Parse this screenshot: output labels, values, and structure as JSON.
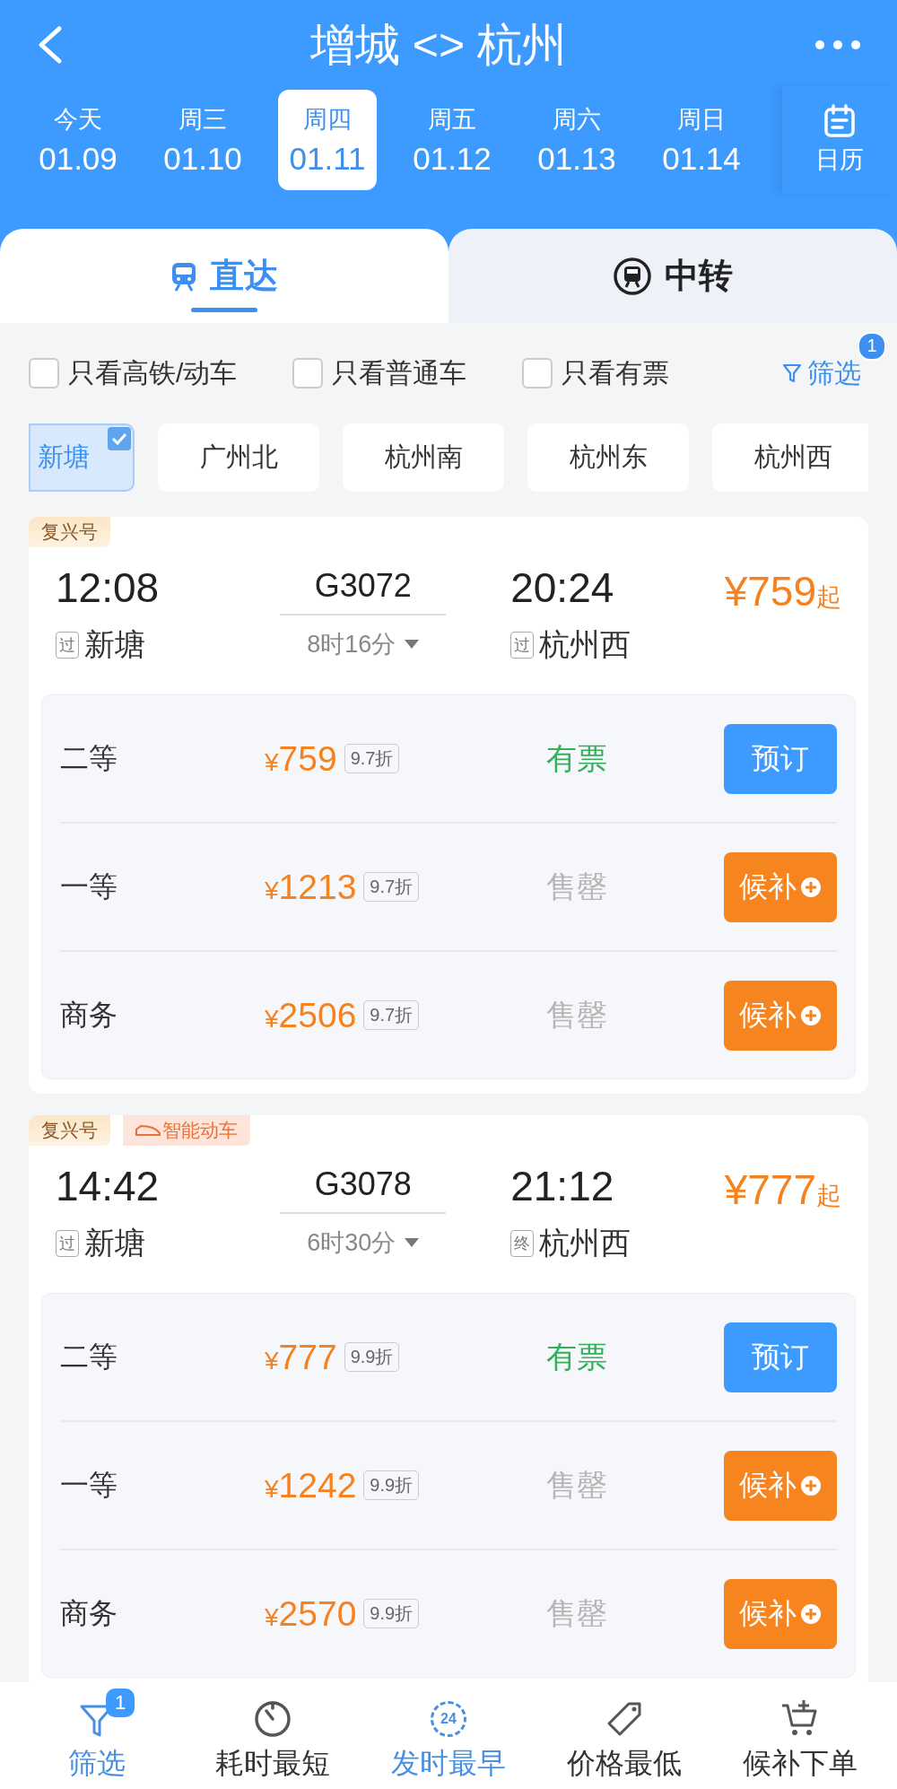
{
  "header": {
    "title": "增城 <> 杭州"
  },
  "dates": [
    {
      "weekday": "今天",
      "date": "01.09",
      "selected": false
    },
    {
      "weekday": "周三",
      "date": "01.10",
      "selected": false
    },
    {
      "weekday": "周四",
      "date": "01.11",
      "selected": true
    },
    {
      "weekday": "周五",
      "date": "01.12",
      "selected": false
    },
    {
      "weekday": "周六",
      "date": "01.13",
      "selected": false
    },
    {
      "weekday": "周日",
      "date": "01.14",
      "selected": false
    }
  ],
  "calendar": {
    "label": "日历"
  },
  "mode_tabs": [
    {
      "label": "直达",
      "kind": "direct",
      "selected": true
    },
    {
      "label": "中转",
      "kind": "transfer",
      "selected": false
    }
  ],
  "filters": [
    {
      "label": "只看高铁/动车",
      "checked": false
    },
    {
      "label": "只看普通车",
      "checked": false
    },
    {
      "label": "只看有票",
      "checked": false
    }
  ],
  "filter_button": {
    "label": "筛选",
    "badge": "1"
  },
  "stations": [
    {
      "label": "新塘",
      "selected": true
    },
    {
      "label": "广州北",
      "selected": false
    },
    {
      "label": "杭州南",
      "selected": false
    },
    {
      "label": "杭州东",
      "selected": false
    },
    {
      "label": "杭州西",
      "selected": false
    }
  ],
  "trains": [
    {
      "tags": [
        {
          "label": "复兴号",
          "kind": "plain"
        }
      ],
      "depart_time": "12:08",
      "depart_mark": "过",
      "depart_station": "新塘",
      "number": "G3072",
      "duration": "8时16分",
      "arrive_time": "20:24",
      "arrive_mark": "过",
      "arrive_station": "杭州西",
      "price": "¥759",
      "price_suffix": "起",
      "seats": [
        {
          "class": "二等",
          "price": "¥759",
          "discount": "9.7折",
          "status": "有票",
          "available": true,
          "action": "预订"
        },
        {
          "class": "一等",
          "price": "¥1213",
          "discount": "9.7折",
          "status": "售罄",
          "available": false,
          "action": "候补"
        },
        {
          "class": "商务",
          "price": "¥2506",
          "discount": "9.7折",
          "status": "售罄",
          "available": false,
          "action": "候补"
        }
      ]
    },
    {
      "tags": [
        {
          "label": "复兴号",
          "kind": "plain"
        },
        {
          "label": "智能动车",
          "kind": "smart"
        }
      ],
      "depart_time": "14:42",
      "depart_mark": "过",
      "depart_station": "新塘",
      "number": "G3078",
      "duration": "6时30分",
      "arrive_time": "21:12",
      "arrive_mark": "终",
      "arrive_station": "杭州西",
      "price": "¥777",
      "price_suffix": "起",
      "seats": [
        {
          "class": "二等",
          "price": "¥777",
          "discount": "9.9折",
          "status": "有票",
          "available": true,
          "action": "预订"
        },
        {
          "class": "一等",
          "price": "¥1242",
          "discount": "9.9折",
          "status": "售罄",
          "available": false,
          "action": "候补"
        },
        {
          "class": "商务",
          "price": "¥2570",
          "discount": "9.9折",
          "status": "售罄",
          "available": false,
          "action": "候补"
        }
      ]
    }
  ],
  "bottom_bar": [
    {
      "label": "筛选",
      "kind": "filter",
      "badge": "1",
      "selected": true
    },
    {
      "label": "耗时最短",
      "kind": "timer",
      "selected": false
    },
    {
      "label": "发时最早",
      "kind": "clock",
      "icon_text": "24",
      "selected": true
    },
    {
      "label": "价格最低",
      "kind": "tag",
      "selected": false
    },
    {
      "label": "候补下单",
      "kind": "cart",
      "selected": false
    }
  ]
}
